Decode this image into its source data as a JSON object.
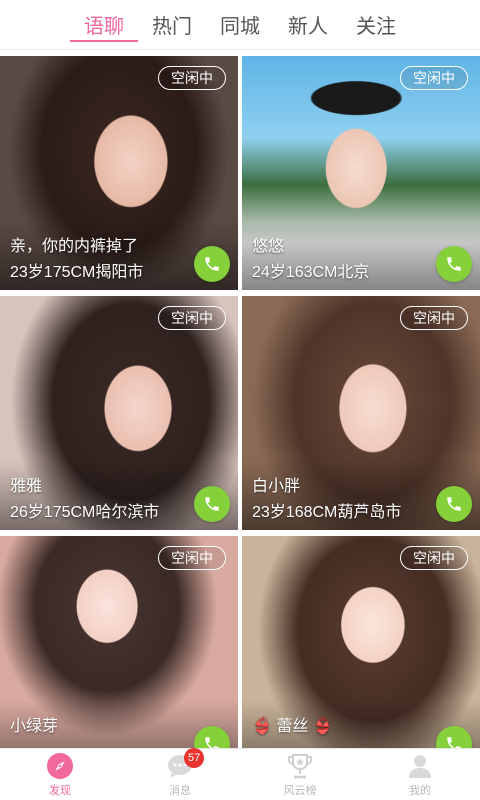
{
  "tabs": [
    "语聊",
    "热门",
    "同城",
    "新人",
    "关注"
  ],
  "active_tab": "语聊",
  "cards": [
    {
      "status": "空闲中",
      "name": "亲，你的内裤掉了",
      "info": "23岁175CM揭阳市"
    },
    {
      "status": "空闲中",
      "name": "悠悠",
      "info": "24岁163CM北京"
    },
    {
      "status": "空闲中",
      "name": "雅雅",
      "info": "26岁175CM哈尔滨市"
    },
    {
      "status": "空闲中",
      "name": "白小胖",
      "info": "23岁168CM葫芦岛市"
    },
    {
      "status": "空闲中",
      "name": "小绿芽",
      "info": ""
    },
    {
      "status": "空闲中",
      "name": "👙 蕾丝 👙",
      "info": ""
    }
  ],
  "bottom_nav": [
    {
      "label": "发现",
      "icon": "compass-icon",
      "active": true
    },
    {
      "label": "消息",
      "icon": "chat-bubble-icon",
      "badge": "57"
    },
    {
      "label": "风云榜",
      "icon": "trophy-icon"
    },
    {
      "label": "我的",
      "icon": "user-icon"
    }
  ],
  "colors": {
    "accent": "#f0689c",
    "call_green": "#86d13a",
    "badge_red": "#e8342e",
    "inactive": "#b8b8b8"
  }
}
